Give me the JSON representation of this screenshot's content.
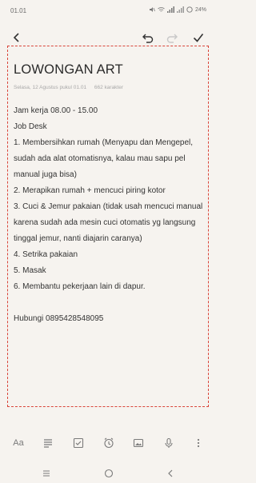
{
  "status": {
    "time": "01.01",
    "battery": "24%"
  },
  "toolbar": {
    "back_icon": "chevron-left-icon",
    "undo_icon": "undo-icon",
    "redo_icon": "redo-icon",
    "done_icon": "check-icon"
  },
  "note": {
    "title": "LOWONGAN ART",
    "date": "Selasa, 12 Agustus pukul 01.01",
    "chars": "662 karakter",
    "lines": [
      "Jam kerja 08.00 - 15.00",
      "Job Desk",
      "1. Membersihkan rumah (Menyapu dan Mengepel,",
      "sudah ada alat otomatisnya, kalau mau sapu pel",
      "manual juga bisa)",
      "2. Merapikan rumah + mencuci piring kotor",
      "3. Cuci & Jemur pakaian (tidak usah mencuci manual",
      "karena sudah ada mesin cuci otomatis yg langsung",
      "tinggal jemur, nanti diajarin caranya)",
      "4. Setrika pakaian",
      "5. Masak",
      "6. Membantu pekerjaan lain di dapur.",
      "",
      "Hubungi 0895428548095"
    ]
  },
  "bottom_toolbar": {
    "text_format_label": "Aa"
  },
  "colors": {
    "accent": "#d9453a",
    "background": "#f6f3ef"
  }
}
